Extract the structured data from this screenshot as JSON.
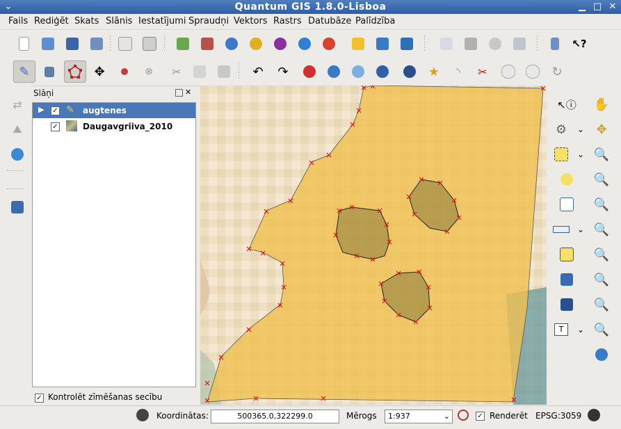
{
  "window": {
    "title": "Quantum GIS 1.8.0-Lisboa"
  },
  "menu": [
    "Fails",
    "Rediģēt",
    "Skats",
    "Slānis",
    "Iestatījumi",
    "Spraudņi",
    "Vektors",
    "Rastrs",
    "Datubāze",
    "Palīdzība"
  ],
  "layers_panel": {
    "title": "Slāņi",
    "layers": [
      {
        "name": "augtenes",
        "checked": true,
        "selected": true,
        "icon": "pencil-edit-icon"
      },
      {
        "name": "Daugavgriiva_2010",
        "checked": true,
        "selected": false,
        "icon": "raster-layer-icon"
      }
    ],
    "render_order_checkbox": "Kontrolēt zīmēšanas secību"
  },
  "status": {
    "coords_label": "Koordinātas:",
    "coords_value": "500365.0,322299.0",
    "scale_label": "Mērogs",
    "scale_value": "1:937",
    "render_label": "Renderēt",
    "epsg": "EPSG:3059"
  },
  "colors": {
    "titlebar": "#3c6cb0",
    "selection": "#4a77b8",
    "polygon_fill": "#f0c050",
    "vertex_marker": "#e01010"
  }
}
